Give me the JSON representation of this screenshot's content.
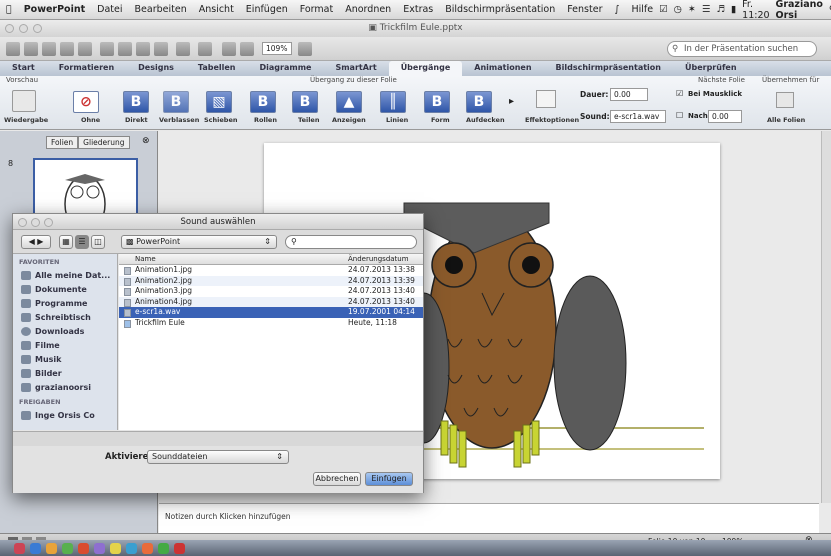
{
  "menubar": {
    "app": "PowerPoint",
    "items": [
      "Datei",
      "Bearbeiten",
      "Ansicht",
      "Einfügen",
      "Format",
      "Anordnen",
      "Extras",
      "Bildschirmpräsentation",
      "Fenster"
    ],
    "help": "Hilfe",
    "clock": "Fr. 11:20",
    "user": "Graziano Orsi"
  },
  "window": {
    "title": "Trickfilm Eule.pptx",
    "zoom": "109%",
    "search_placeholder": "In der Präsentation suchen"
  },
  "tabs": [
    "Start",
    "Formatieren",
    "Designs",
    "Tabellen",
    "Diagramme",
    "SmartArt",
    "Übergänge",
    "Animationen",
    "Bildschirmpräsentation",
    "Überprüfen"
  ],
  "active_tab": "Übergänge",
  "ribbon": {
    "group_preview": "Vorschau",
    "preview_label": "Wiedergabe",
    "group_transition": "Übergang zu dieser Folie",
    "transitions": [
      "Ohne",
      "Direkt",
      "Verblassen",
      "Schieben",
      "Rollen",
      "Teilen",
      "Anzeigen",
      "Linien",
      "Form",
      "Aufdecken"
    ],
    "effect_options": "Effektoptionen",
    "duration_label": "Dauer:",
    "duration_value": "0.00",
    "sound_label": "Sound:",
    "sound_value": "e-scr1a.wav",
    "group_next": "Nächste Folie",
    "on_click": "Bei Mausklick",
    "after_label": "Nach:",
    "after_value": "0.00",
    "group_apply": "Übernehmen für",
    "apply_all": "Alle Folien"
  },
  "sidebar": {
    "tab_slides": "Folien",
    "tab_outline": "Gliederung",
    "slide_number": "8"
  },
  "notes_placeholder": "Notizen durch Klicken hinzufügen",
  "status": {
    "slide": "Folie 10 von 10",
    "zoom": "109%"
  },
  "dialog": {
    "title": "Sound auswählen",
    "location": "PowerPoint",
    "favorites_header": "FAVORITEN",
    "favorites": [
      "Alle meine Dat...",
      "Dokumente",
      "Programme",
      "Schreibtisch",
      "Downloads",
      "Filme",
      "Musik",
      "Bilder",
      "grazianoorsi"
    ],
    "shared_header": "FREIGABEN",
    "shared_item": "Inge Orsis Co",
    "col_name": "Name",
    "col_date": "Änderungsdatum",
    "files": [
      {
        "name": "Animation1.jpg",
        "date": "24.07.2013 13:38"
      },
      {
        "name": "Animation2.jpg",
        "date": "24.07.2013 13:39"
      },
      {
        "name": "Animation3.jpg",
        "date": "24.07.2013 13:40"
      },
      {
        "name": "Animation4.jpg",
        "date": "24.07.2013 13:40"
      },
      {
        "name": "e-scr1a.wav",
        "date": "19.07.2001 04:14"
      },
      {
        "name": "Trickfilm Eule",
        "date": "Heute, 11:18"
      }
    ],
    "selected_file": "e-scr1a.wav",
    "enable_label": "Aktivieren:",
    "enable_value": "Sounddateien",
    "cancel": "Abbrechen",
    "insert": "Einfügen"
  },
  "colors": {
    "accent": "#3a62b6",
    "owl_body": "#8a5a2b",
    "hat": "#5c5c5c",
    "feet": "#c8d433"
  }
}
